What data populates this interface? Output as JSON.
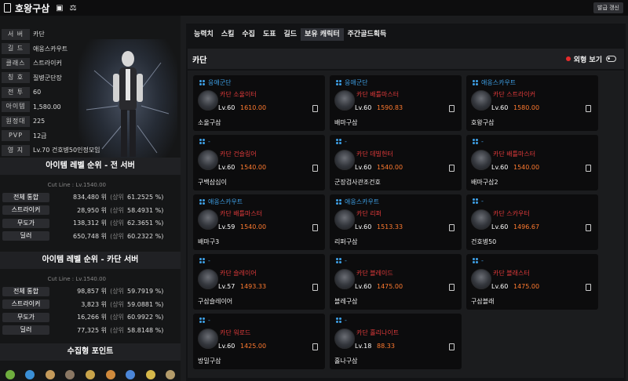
{
  "topbar": {
    "icon": "bookmark-icon",
    "title": "호왕구삼",
    "refresh": "발급 갱신"
  },
  "profile": [
    {
      "label": "서 버",
      "value": "카단"
    },
    {
      "label": "길 드",
      "value": "애옹스카우트"
    },
    {
      "label": "클래스",
      "value": "스트라이커"
    },
    {
      "label": "칭 호",
      "value": "질병군단장"
    },
    {
      "label": "전 투",
      "value": "60"
    },
    {
      "label": "아이템",
      "value": "1,580.00"
    },
    {
      "label": "원정대",
      "value": "225"
    },
    {
      "label": "PVP",
      "value": "12급"
    },
    {
      "label": "영 지",
      "value": "Lv.70 건호병50인정모임"
    }
  ],
  "rank_all": {
    "title": "아이템 레벨 순위 - 전 서버",
    "cutline": "Cut Line : Lv.1540.00",
    "rows": [
      {
        "label": "전체 통합",
        "rank": "834,480 위",
        "sub": "(상위",
        "pct": "61.2525 %)"
      },
      {
        "label": "스트라이커",
        "rank": "28,950 위",
        "sub": "(상위",
        "pct": "58.4931 %)"
      },
      {
        "label": "무도가",
        "rank": "138,312 위",
        "sub": "(상위",
        "pct": "62.3651 %)"
      },
      {
        "label": "딜러",
        "rank": "650,748 위",
        "sub": "(상위",
        "pct": "60.2322 %)"
      }
    ]
  },
  "rank_server": {
    "title": "아이템 레벨 순위 - 카단 서버",
    "cutline": "Cut Line : Lv.1540.00",
    "rows": [
      {
        "label": "전체 통합",
        "rank": "98,857 위",
        "sub": "(상위",
        "pct": "59.7919 %)"
      },
      {
        "label": "스트라이커",
        "rank": "3,823 위",
        "sub": "(상위",
        "pct": "59.0881 %)"
      },
      {
        "label": "무도가",
        "rank": "16,266 위",
        "sub": "(상위",
        "pct": "60.9922 %)"
      },
      {
        "label": "딜러",
        "rank": "77,325 위",
        "sub": "(상위",
        "pct": "58.8148 %)"
      }
    ]
  },
  "collect": {
    "title": "수집형 포인트"
  },
  "tabs": [
    "능력치",
    "스킬",
    "수집",
    "도표",
    "길드",
    "보유 캐릭터",
    "주간골드획득"
  ],
  "active_tab": 5,
  "roster": {
    "header": "카단",
    "toggle_label": "외형 보기",
    "cards": [
      {
        "guild": "응애군단",
        "server": "카단",
        "cls": "소울이터",
        "lv": "Lv.60",
        "il": "1610.00",
        "name": "소울구삼"
      },
      {
        "guild": "응애군단",
        "server": "카단",
        "cls": "배틀마스터",
        "lv": "Lv.60",
        "il": "1590.83",
        "name": "배마구삼"
      },
      {
        "guild": "애옹스카우트",
        "server": "카단",
        "cls": "스트라이커",
        "lv": "Lv.60",
        "il": "1580.00",
        "name": "호왕구삼"
      },
      {
        "guild": "-",
        "server": "카단",
        "cls": "건슬링어",
        "lv": "Lv.60",
        "il": "1540.00",
        "name": "구백삼십이"
      },
      {
        "guild": "-",
        "server": "카단",
        "cls": "데빌헌터",
        "lv": "Lv.60",
        "il": "1540.00",
        "name": "군장검사관조건호"
      },
      {
        "guild": "-",
        "server": "카단",
        "cls": "배틀마스터",
        "lv": "Lv.60",
        "il": "1540.00",
        "name": "배마구삼2"
      },
      {
        "guild": "애옹스카우트",
        "server": "카단",
        "cls": "배틀마스터",
        "lv": "Lv.59",
        "il": "1540.00",
        "name": "배마구3"
      },
      {
        "guild": "애옹스카우트",
        "server": "카단",
        "cls": "리퍼",
        "lv": "Lv.60",
        "il": "1513.33",
        "name": "리퍼구삼"
      },
      {
        "guild": "-",
        "server": "카단",
        "cls": "스카우터",
        "lv": "Lv.60",
        "il": "1496.67",
        "name": "건호병50"
      },
      {
        "guild": "-",
        "server": "카단",
        "cls": "슬레이어",
        "lv": "Lv.57",
        "il": "1493.33",
        "name": "구삼슬레이어"
      },
      {
        "guild": "-",
        "server": "카단",
        "cls": "블레이드",
        "lv": "Lv.60",
        "il": "1475.00",
        "name": "블레구삼"
      },
      {
        "guild": "-",
        "server": "카단",
        "cls": "블래스터",
        "lv": "Lv.60",
        "il": "1475.00",
        "name": "구삼블래"
      },
      {
        "guild": "-",
        "server": "카단",
        "cls": "워로드",
        "lv": "Lv.60",
        "il": "1425.00",
        "name": "방밀구삼"
      },
      {
        "guild": "-",
        "server": "카단",
        "cls": "홀리나이트",
        "lv": "Lv.18",
        "il": "88.33",
        "name": "홀나구삼"
      }
    ]
  },
  "colors": {
    "accent_blue": "#3ea0e6",
    "server_red": "#e03a3a",
    "ilvl_orange": "#ff7a2f"
  }
}
